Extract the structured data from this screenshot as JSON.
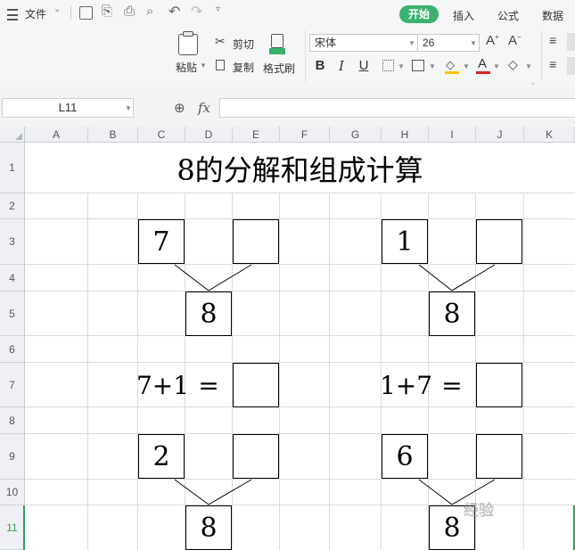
{
  "toolbar": {
    "file_menu": "文件",
    "tabs": [
      "开始",
      "插入",
      "公式",
      "数据"
    ],
    "paste": "粘贴",
    "cut": "剪切",
    "copy": "复制",
    "format_painter": "格式刷",
    "font_name": "宋体",
    "font_size": "26"
  },
  "formula_bar": {
    "name_box": "L11",
    "fx_label": "fx",
    "formula": ""
  },
  "sheet": {
    "columns": [
      "A",
      "B",
      "C",
      "D",
      "E",
      "F",
      "G",
      "H",
      "I",
      "J",
      "K"
    ],
    "rows": [
      "1",
      "2",
      "3",
      "4",
      "5",
      "6",
      "7",
      "8",
      "9",
      "10",
      "11"
    ],
    "title": "8的分解和组成计算",
    "problems": [
      {
        "left": "7",
        "right": "",
        "bottom": "8"
      },
      {
        "left": "1",
        "right": "",
        "bottom": "8"
      },
      {
        "left": "2",
        "right": "",
        "bottom": "8"
      },
      {
        "left": "6",
        "right": "",
        "bottom": "8"
      }
    ],
    "equations": [
      {
        "expr": "7+1",
        "eq": "=",
        "answer": ""
      },
      {
        "expr": "1+7",
        "eq": "=",
        "answer": ""
      }
    ]
  },
  "watermark": "经验"
}
